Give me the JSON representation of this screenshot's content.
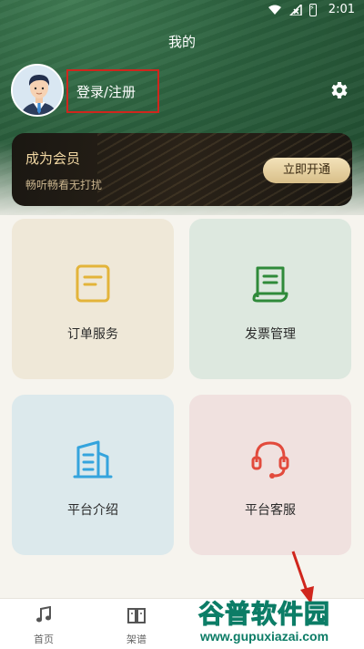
{
  "statusbar": {
    "time": "2:01"
  },
  "header": {
    "title": "我的"
  },
  "profile": {
    "login_label": "登录/注册"
  },
  "vip": {
    "title": "成为会员",
    "subtitle": "畅听畅看无打扰",
    "button_label": "立即开通"
  },
  "tiles": [
    {
      "label": "订单服务",
      "icon": "order-icon",
      "color": "#e3b43a"
    },
    {
      "label": "发票管理",
      "icon": "invoice-icon",
      "color": "#2f8a3a"
    },
    {
      "label": "平台介绍",
      "icon": "building-icon",
      "color": "#35a4dd"
    },
    {
      "label": "平台客服",
      "icon": "headset-icon",
      "color": "#e24a3c"
    }
  ],
  "bottom_nav": [
    {
      "label": "首页",
      "icon": "music-note-icon"
    },
    {
      "label": "架谱",
      "icon": "book-icon"
    }
  ],
  "watermark": {
    "title": "谷普软件园",
    "url": "www.gupuxiazai.com"
  }
}
